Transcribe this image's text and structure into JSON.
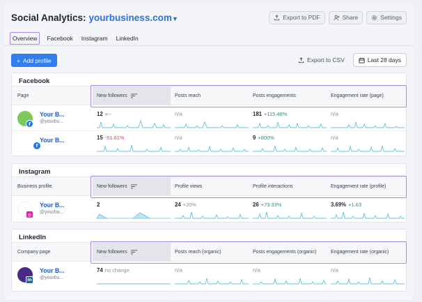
{
  "header": {
    "title": "Social Analytics:",
    "domain": "yourbusiness.com",
    "export_pdf": "Export to PDF",
    "share": "Share",
    "settings": "Settings"
  },
  "tabs": [
    "Overview",
    "Facebook",
    "Instagram",
    "LinkedIn"
  ],
  "toolbar": {
    "add_profile": "Add profile",
    "export_csv": "Export to CSV",
    "date_range": "Last 28 days"
  },
  "colors": {
    "accent": "#2f7ff0",
    "highlight": "#a98be0",
    "positive": "#1aa05a",
    "negative": "#e04444",
    "spark": "#5fc0e6"
  },
  "sections": [
    {
      "title": "Facebook",
      "first_col": "Page",
      "columns": [
        "New followers",
        "Posts reach",
        "Posts engagements",
        "Engagement rate (page)"
      ],
      "rows": [
        {
          "name": "Your B...",
          "handle": "@yourbu...",
          "avatar": "green",
          "badge": "facebook-icon",
          "cells": [
            {
              "value": "12",
              "delta": "+--",
              "trend": "pos"
            },
            {
              "value": "n/a",
              "delta": "",
              "trend": ""
            },
            {
              "value": "181",
              "delta": "+115.48%",
              "trend": "pos"
            },
            {
              "value": "n/a",
              "delta": "",
              "trend": ""
            }
          ]
        },
        {
          "name": "Your B...",
          "handle": "",
          "avatar": "none",
          "badge": "facebook-icon",
          "cells": [
            {
              "value": "15",
              "delta": "-51.61%",
              "trend": "neg"
            },
            {
              "value": "n/a",
              "delta": "",
              "trend": ""
            },
            {
              "value": "9",
              "delta": "+800%",
              "trend": "pos"
            },
            {
              "value": "n/a",
              "delta": "",
              "trend": ""
            }
          ]
        }
      ]
    },
    {
      "title": "Instagram",
      "first_col": "Business profile",
      "columns": [
        "New followers",
        "Profile views",
        "Profile interactions",
        "Engagement rate (profile)"
      ],
      "rows": [
        {
          "name": "Your B...",
          "handle": "@yourbu...",
          "avatar": "none",
          "badge": "instagram-icon",
          "cells": [
            {
              "value": "2",
              "delta": "",
              "trend": ""
            },
            {
              "value": "24",
              "delta": "+20%",
              "trend": "mute"
            },
            {
              "value": "26",
              "delta": "+73.33%",
              "trend": "pos"
            },
            {
              "value": "3.69%",
              "delta": "+1.63",
              "trend": "pos"
            }
          ]
        }
      ]
    },
    {
      "title": "LinkedIn",
      "first_col": "Company page",
      "columns": [
        "New followers",
        "Posts reach (organic)",
        "Posts engagements (organic)",
        "Engagement rate (organic)"
      ],
      "rows": [
        {
          "name": "Your B...",
          "handle": "@yourbu...",
          "avatar": "purple",
          "badge": "linkedin-icon",
          "cells": [
            {
              "value": "74",
              "delta": "no change",
              "trend": "mute"
            },
            {
              "value": "n/a",
              "delta": "",
              "trend": ""
            },
            {
              "value": "n/a",
              "delta": "",
              "trend": ""
            },
            {
              "value": "n/a",
              "delta": "",
              "trend": ""
            }
          ]
        }
      ]
    }
  ]
}
